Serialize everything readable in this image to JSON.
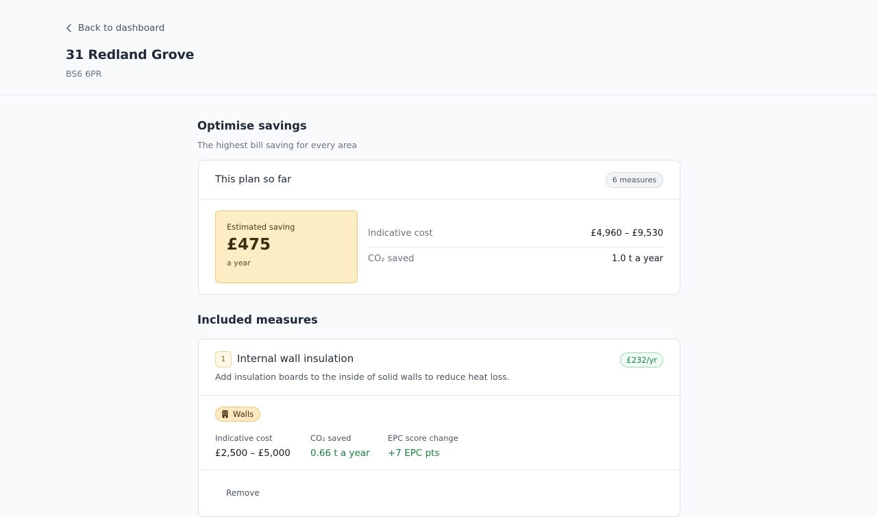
{
  "header": {
    "back_label": "Back to dashboard",
    "title": "31 Redland Grove",
    "postcode": "BS6 6PR"
  },
  "optimise": {
    "title": "Optimise savings",
    "subtitle": "The highest bill saving for every area"
  },
  "plan": {
    "title": "This plan so far",
    "measures_badge": "6 measures",
    "saving_label": "Estimated saving",
    "saving_value": "£475",
    "saving_period": "a year",
    "cost_label": "Indicative cost",
    "cost_value": "£4,960 – £9,530",
    "co2_label": "CO₂ saved",
    "co2_value": "1.0 t a year"
  },
  "included": {
    "title": "Included measures",
    "measures": [
      {
        "number": "1",
        "title": "Internal wall insulation",
        "description": "Add insulation boards to the inside of solid walls to reduce heat loss.",
        "saving_badge": "£232/yr",
        "area_tag": "Walls",
        "area_icon": "building-icon",
        "cost_label": "Indicative cost",
        "cost_value": "£2,500 – £5,000",
        "co2_label": "CO₂ saved",
        "co2_value": "0.66 t a year",
        "epc_label": "EPC score change",
        "epc_value": "+7 EPC pts",
        "next_action": "Remove"
      }
    ]
  },
  "colors": {
    "accent_amber_bg": "#fdedc4",
    "accent_amber_border": "#f1c775",
    "positive_green": "#15803d",
    "page_bg": "#f8fafc"
  }
}
